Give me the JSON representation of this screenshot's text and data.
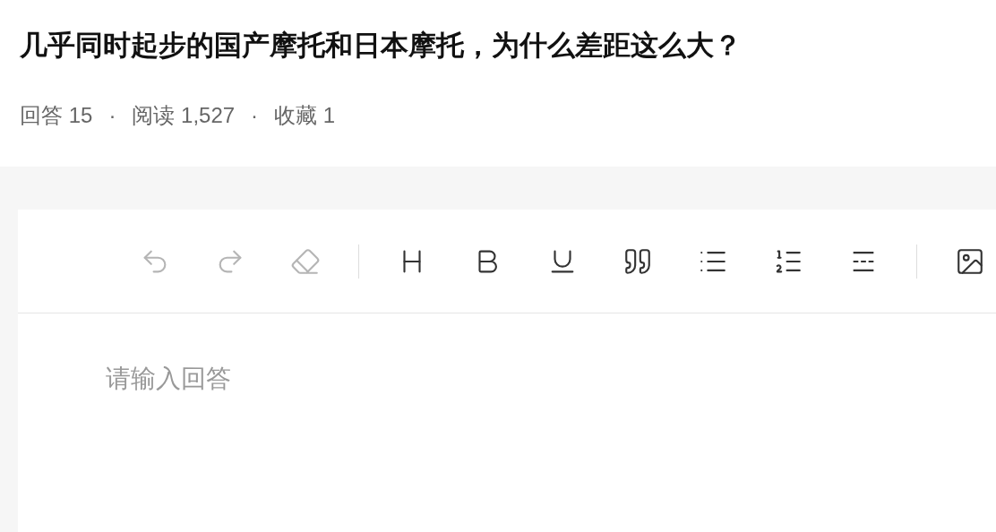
{
  "question": {
    "title": "几乎同时起步的国产摩托和日本摩托，为什么差距这么大？",
    "stats": [
      {
        "label": "回答 15"
      },
      {
        "label": "阅读 1,527"
      },
      {
        "label": "收藏 1"
      }
    ],
    "separator": "·"
  },
  "toolbar": [
    {
      "kind": "button",
      "disabled": true
    },
    {
      "kind": "button",
      "disabled": true
    },
    {
      "kind": "button",
      "disabled": true
    },
    {
      "kind": "separator"
    },
    {
      "kind": "button",
      "disabled": false
    },
    {
      "kind": "button",
      "disabled": false
    },
    {
      "kind": "button",
      "disabled": false
    },
    {
      "kind": "button",
      "disabled": false
    },
    {
      "kind": "button",
      "disabled": false
    },
    {
      "kind": "button",
      "disabled": false
    },
    {
      "kind": "button",
      "disabled": false
    },
    {
      "kind": "separator"
    },
    {
      "kind": "button",
      "disabled": false
    }
  ],
  "editor": {
    "placeholder": "请输入回答"
  }
}
